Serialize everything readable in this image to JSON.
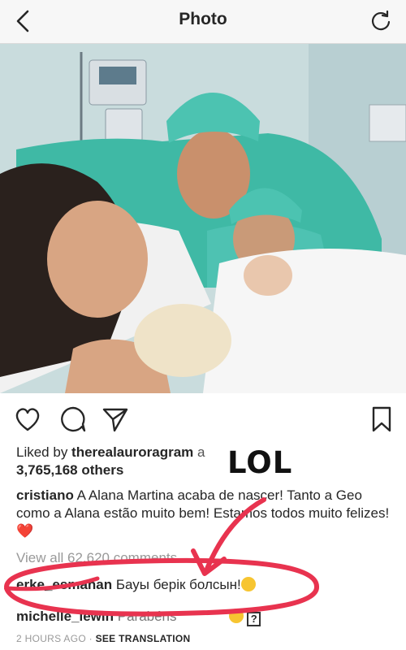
{
  "header": {
    "title": "Photo",
    "back_icon": "chevron-left-icon",
    "refresh_icon": "refresh-icon"
  },
  "post": {
    "photo_alt": "Hospital photo",
    "likes": {
      "prefix": "Liked by ",
      "user": "therealauroragram",
      "suffix": " a",
      "count": "3,765,168 others"
    },
    "caption": {
      "user": "cristiano",
      "text": "A Alana Martina acaba de nascer! Tanto a Geo como a Alana estão muito bem! Estamos todos muito felizes! ❤️"
    },
    "view_all": "View all 62,620 comments",
    "comments": [
      {
        "user": "erke_esmahan",
        "text": "Бауы берік болсын!"
      },
      {
        "user": "michelle_lewin",
        "text": "Parabéns"
      }
    ],
    "timestamp": "2 HOURS AGO",
    "separator": " · ",
    "see_translation": "SEE TRANSLATION"
  },
  "annotation": {
    "text": "LOL",
    "color": "#e8334f"
  },
  "colors": {
    "heart": "#ed4956",
    "annotation_red": "#e8334f"
  }
}
